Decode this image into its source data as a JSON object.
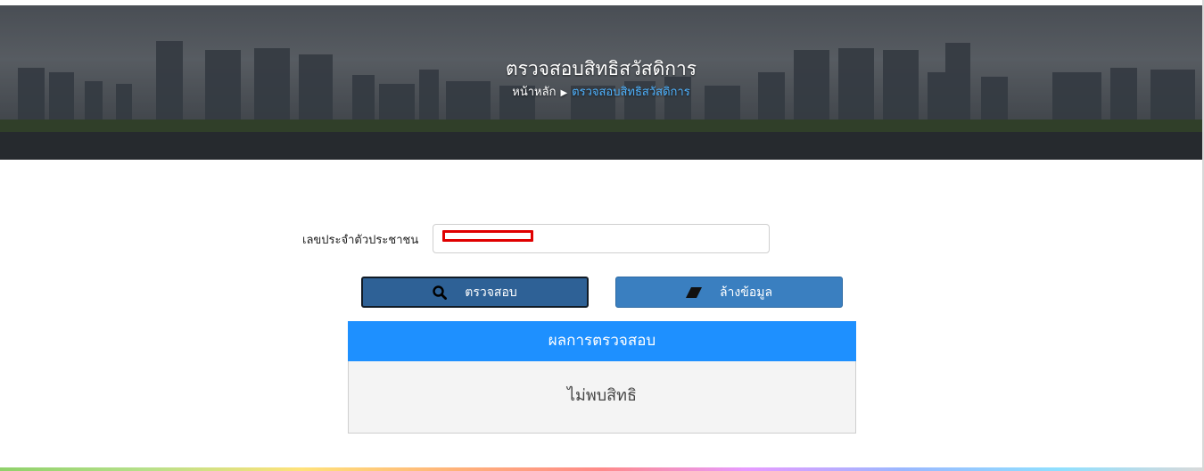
{
  "banner": {
    "title": "ตรวจสอบสิทธิสวัสดิการ",
    "breadcrumb": {
      "home": "หน้าหลัก",
      "separator": "▶",
      "current": "ตรวจสอบสิทธิสวัสดิการ"
    }
  },
  "form": {
    "id_label": "เลขประจำตัวประชาชน",
    "id_value": ""
  },
  "buttons": {
    "search_label": "ตรวจสอบ",
    "search_icon": "search-icon",
    "clear_label": "ล้างข้อมูล",
    "clear_icon": "eraser-icon"
  },
  "result": {
    "header": "ผลการตรวจสอบ",
    "message": "ไม่พบสิทธิ"
  },
  "colors": {
    "primary": "#1e90ff",
    "search_button": "#2e6196",
    "clear_button": "#3a7fc0",
    "breadcrumb_current": "#4fb3ff",
    "redaction": "#e00000"
  }
}
